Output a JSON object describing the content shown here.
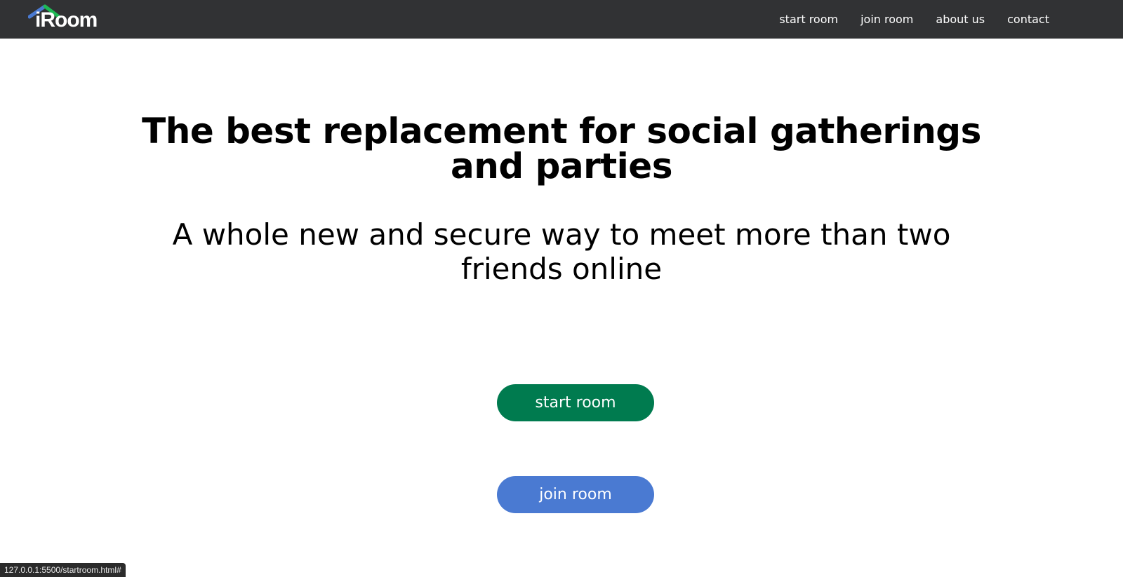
{
  "navbar": {
    "logo_text": "iRoom",
    "logo_icon": "house-roof-icon",
    "links": [
      {
        "label": "start room"
      },
      {
        "label": "join room"
      },
      {
        "label": "about us"
      },
      {
        "label": "contact"
      }
    ]
  },
  "hero": {
    "headline_line1": "The best replacement for social gatherings",
    "headline_line2": "and parties",
    "subheadline_line1": "A whole new and secure way to meet more than two",
    "subheadline_line2": "friends online"
  },
  "actions": {
    "start_label": "start room",
    "join_label": "join room"
  },
  "status_bar": {
    "url": "127.0.0.1:5500/startroom.html#"
  },
  "colors": {
    "navbar_bg": "#313234",
    "start_button": "#007b4f",
    "join_button": "#4a7ad2",
    "roof_blue": "#4a7ad2",
    "roof_green": "#1db954"
  }
}
